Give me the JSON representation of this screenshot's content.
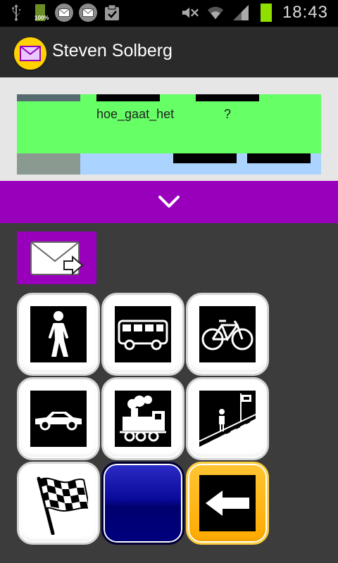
{
  "status_bar": {
    "battery_small_label": "100%",
    "time": "18:43",
    "icons": [
      "usb-icon",
      "battery-icon",
      "mail-notification-icon",
      "mail-notification-icon",
      "clipboard-check-icon",
      "mute-icon",
      "wifi-icon",
      "signal-icon",
      "battery-icon"
    ]
  },
  "action_bar": {
    "title": "Steven Solberg",
    "app_icon": "envelope-icon"
  },
  "message": {
    "words": [
      "hoe_gaat_het",
      "?"
    ]
  },
  "expand_icon": "chevron-down-icon",
  "send_icon": "send-mail-icon",
  "tiles": [
    {
      "name": "walk",
      "icon": "pedestrian-icon"
    },
    {
      "name": "bus",
      "icon": "bus-icon"
    },
    {
      "name": "bicycle",
      "icon": "bicycle-icon"
    },
    {
      "name": "car",
      "icon": "car-icon"
    },
    {
      "name": "train",
      "icon": "train-icon"
    },
    {
      "name": "bus-stop",
      "icon": "bus-stop-icon"
    },
    {
      "name": "finish",
      "icon": "checkered-flag-icon"
    },
    {
      "name": "blank",
      "icon": ""
    },
    {
      "name": "back",
      "icon": "arrow-left-icon"
    }
  ],
  "colors": {
    "accent_purple": "#9900bb",
    "message_green": "#66ff66",
    "message_blue": "#aad4ff",
    "back_orange": "#ffb000",
    "blank_blue": "#000080",
    "app_icon_yellow": "#ffd200"
  }
}
